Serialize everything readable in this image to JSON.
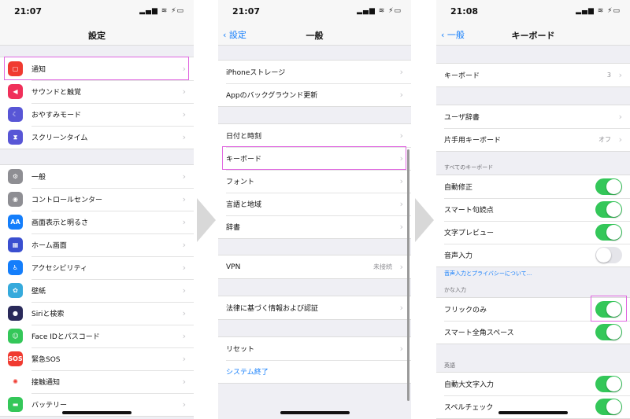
{
  "panels": [
    {
      "time": "21:07",
      "title": "設定",
      "back": null,
      "groups": [
        [
          {
            "label": "通知",
            "icon": "notification-icon",
            "color": "#f03a30",
            "glyph": "▢"
          },
          {
            "label": "サウンドと触覚",
            "icon": "speaker-icon",
            "color": "#f0305a",
            "glyph": "◀"
          },
          {
            "label": "おやすみモード",
            "icon": "moon-icon",
            "color": "#5856d6",
            "glyph": "☾"
          },
          {
            "label": "スクリーンタイム",
            "icon": "hourglass-icon",
            "color": "#5856d6",
            "glyph": "⧗"
          }
        ],
        [
          {
            "label": "一般",
            "icon": "gear-icon",
            "color": "#8e8e93",
            "glyph": "⚙"
          },
          {
            "label": "コントロールセンター",
            "icon": "control-center-icon",
            "color": "#8e8e93",
            "glyph": "◉"
          },
          {
            "label": "画面表示と明るさ",
            "icon": "display-icon",
            "color": "#147efb",
            "glyph": "AA"
          },
          {
            "label": "ホーム画面",
            "icon": "home-screen-icon",
            "color": "#3a4fd0",
            "glyph": "▦"
          },
          {
            "label": "アクセシビリティ",
            "icon": "accessibility-icon",
            "color": "#147efb",
            "glyph": "♿"
          },
          {
            "label": "壁紙",
            "icon": "wallpaper-icon",
            "color": "#35aadc",
            "glyph": "✿"
          },
          {
            "label": "Siriと検索",
            "icon": "siri-icon",
            "color": "#2a2a5a",
            "glyph": "●"
          },
          {
            "label": "Face IDとパスコード",
            "icon": "face-id-icon",
            "color": "#34c759",
            "glyph": "☺"
          },
          {
            "label": "緊急SOS",
            "icon": "sos-icon",
            "color": "#f03a30",
            "glyph": "SOS"
          },
          {
            "label": "接触通知",
            "icon": "exposure-icon",
            "color": "#ffffff",
            "glyph": "✺"
          },
          {
            "label": "バッテリー",
            "icon": "battery-icon",
            "color": "#34c759",
            "glyph": "▬"
          }
        ]
      ]
    },
    {
      "time": "21:07",
      "title": "一般",
      "back": "設定",
      "groups": [
        [
          {
            "label": "iPhoneストレージ"
          },
          {
            "label": "Appのバックグラウンド更新"
          }
        ],
        [
          {
            "label": "日付と時刻"
          },
          {
            "label": "キーボード"
          },
          {
            "label": "フォント"
          },
          {
            "label": "言語と地域"
          },
          {
            "label": "辞書"
          }
        ],
        [
          {
            "label": "VPN",
            "value": "未接続"
          }
        ],
        [
          {
            "label": "法律に基づく情報および認証"
          }
        ],
        [
          {
            "label": "リセット"
          },
          {
            "label": "システム終了",
            "blue": true,
            "nochev": true
          }
        ]
      ]
    },
    {
      "time": "21:08",
      "title": "キーボード",
      "back": "一般",
      "groups": [
        [
          {
            "label": "キーボード",
            "value": "3"
          }
        ],
        [
          {
            "label": "ユーザ辞書"
          },
          {
            "label": "片手用キーボード",
            "value": "オフ"
          }
        ],
        [
          {
            "label": "自動修正",
            "toggle": true
          },
          {
            "label": "スマート句読点",
            "toggle": true
          },
          {
            "label": "文字プレビュー",
            "toggle": true
          },
          {
            "label": "音声入力",
            "toggle": false
          }
        ],
        [
          {
            "label": "フリックのみ",
            "toggle": true
          },
          {
            "label": "スマート全角スペース",
            "toggle": true
          }
        ],
        [
          {
            "label": "自動大文字入力",
            "toggle": true
          },
          {
            "label": "スペルチェック",
            "toggle": true
          }
        ]
      ],
      "sections": [
        "すべてのキーボード",
        "かな入力",
        "英語"
      ],
      "link": "音声入力とプライバシーについて..."
    }
  ],
  "status": "▂▄▆ ≋ ⚡▭",
  "colors": {
    "accent": "#147efb",
    "toggle_on": "#34c759",
    "highlight": "#e066e0"
  }
}
